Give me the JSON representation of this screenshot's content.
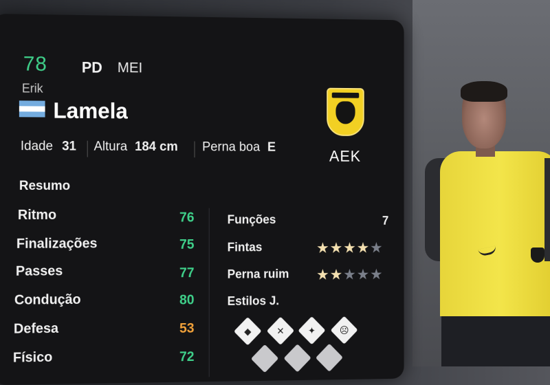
{
  "player": {
    "overall": "78",
    "position": "PD",
    "alt_position": "MEI",
    "first_name": "Erik",
    "last_name": "Lamela",
    "nation_flag": "argentina-flag",
    "age_label": "Idade",
    "age": "31",
    "height_label": "Altura",
    "height": "184 cm",
    "foot_label": "Perna boa",
    "foot": "E",
    "club": "AEK",
    "club_crest": "aek-crest"
  },
  "summary": {
    "title": "Resumo",
    "stats": [
      {
        "label": "Ritmo",
        "value": "76",
        "color": "#3fd08a"
      },
      {
        "label": "Finalizações",
        "value": "75",
        "color": "#3fd08a"
      },
      {
        "label": "Passes",
        "value": "77",
        "color": "#3fd08a"
      },
      {
        "label": "Condução",
        "value": "80",
        "color": "#3fd08a"
      },
      {
        "label": "Defesa",
        "value": "53",
        "color": "#f2a23a"
      },
      {
        "label": "Físico",
        "value": "72",
        "color": "#3fd08a"
      }
    ]
  },
  "extras": {
    "functions_label": "Funções",
    "functions_value": "7",
    "skill_moves_label": "Fintas",
    "skill_moves_stars": 4,
    "weak_foot_label": "Perna ruim",
    "weak_foot_stars": 2,
    "max_stars": 5,
    "playstyles_label": "Estilos J.",
    "playstyle_icons": [
      "playstyle-1-icon",
      "playstyle-2-icon",
      "playstyle-3-icon",
      "playstyle-4-icon",
      "playstyle-5-icon",
      "playstyle-6-icon",
      "playstyle-7-icon"
    ]
  },
  "colors": {
    "positive": "#3fd08a",
    "warning": "#f2a23a",
    "panel": "#141416",
    "kit_yellow": "#f3e54a"
  }
}
